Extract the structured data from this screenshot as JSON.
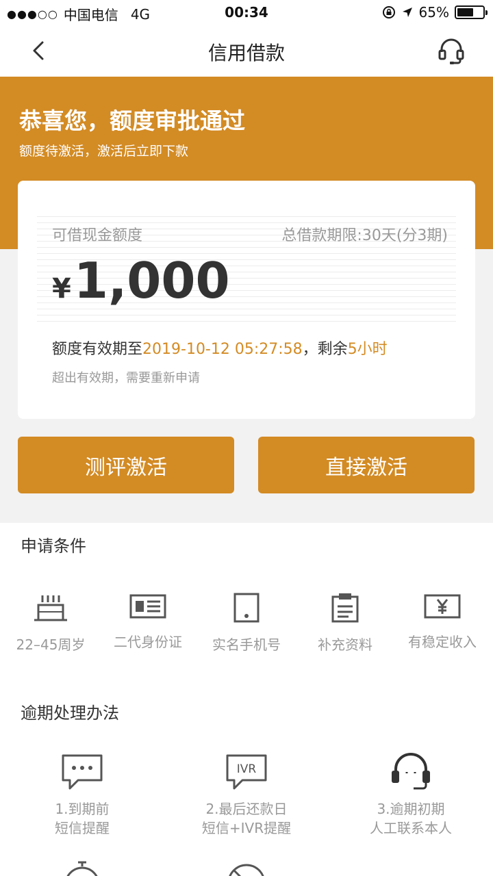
{
  "status_bar": {
    "carrier": "中国电信",
    "network": "4G",
    "time": "00:34",
    "battery": "65%",
    "battery_level": 0.65
  },
  "nav": {
    "title": "信用借款",
    "back_icon": "chevron-left-icon",
    "service_icon": "headset-icon"
  },
  "banner": {
    "title": "恭喜您，额度审批通过",
    "subtitle": "额度待激活，激活后立即下款"
  },
  "card": {
    "label": "可借现金额度",
    "term": "总借款期限:30天(分3期)",
    "currency": "¥",
    "amount": "1,000",
    "validity_prefix": "额度有效期至",
    "validity_date": "2019-10-12 05:27:58",
    "validity_mid": "，剩余",
    "validity_remaining": "5小时",
    "expire_note": "超出有效期，需要重新申请"
  },
  "buttons": {
    "evaluate_label": "测评激活",
    "direct_label": "直接激活"
  },
  "conditions": {
    "title": "申请条件",
    "items": [
      {
        "label": "22–45周岁",
        "icon": "cake-icon"
      },
      {
        "label": "二代身份证",
        "icon": "id-card-icon"
      },
      {
        "label": "实名手机号",
        "icon": "phone-icon"
      },
      {
        "label": "补充资料",
        "icon": "clipboard-icon"
      },
      {
        "label": "有稳定收入",
        "icon": "yen-card-icon"
      }
    ]
  },
  "overdue": {
    "title": "逾期处理办法",
    "items": [
      {
        "line1": "1.到期前",
        "line2": "短信提醒",
        "icon": "sms-icon"
      },
      {
        "line1": "2.最后还款日",
        "line2": "短信+IVR提醒",
        "icon": "ivr-icon",
        "icon_text": "IVR"
      },
      {
        "line1": "3.逾期初期",
        "line2": "人工联系本人",
        "icon": "headset-icon"
      }
    ]
  },
  "colors": {
    "accent": "#d38b24",
    "background": "#f2f2f2"
  }
}
